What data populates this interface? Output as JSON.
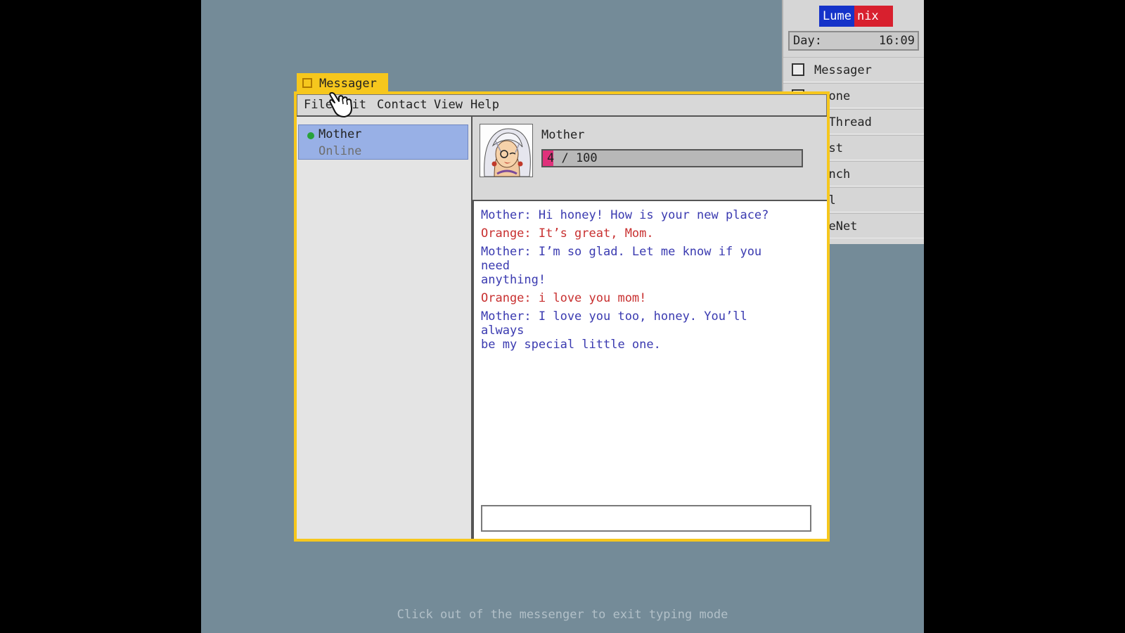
{
  "taskbar": {
    "brand_part1": "Lume",
    "brand_part2": "nix",
    "brand_colors": {
      "blue": "#1533c9",
      "red": "#d8202e"
    },
    "clock_label": "Day:",
    "clock_time": "16:09",
    "items": [
      {
        "label": "Messager"
      },
      {
        "label": "azone"
      },
      {
        "label": "lkThread"
      },
      {
        "label": "tist"
      },
      {
        "label": "Ranch"
      },
      {
        "label": "ail"
      },
      {
        "label": "adeNet"
      }
    ]
  },
  "window": {
    "title": "Messager",
    "accent_color": "#f6c71d",
    "menu": {
      "file": "File",
      "edit": "Edit",
      "contact": "Contact",
      "view": "View",
      "help": "Help"
    }
  },
  "contacts": [
    {
      "name": "Mother",
      "status": "Online",
      "status_color": "#28a23a"
    }
  ],
  "chat": {
    "contact_name": "Mother",
    "affinity_value": 4,
    "affinity_max": 100,
    "affinity_text": "4 / 100",
    "affinity_color": "#e0317b",
    "messages": [
      {
        "speaker": "mother",
        "text": "Mother: Hi honey! How is your new place?"
      },
      {
        "speaker": "orange",
        "text": "Orange: It’s great, Mom."
      },
      {
        "speaker": "mother",
        "text": "Mother: I’m so glad. Let me know if you need\nanything!"
      },
      {
        "speaker": "orange",
        "text": "Orange: i love you mom!"
      },
      {
        "speaker": "mother",
        "text": "Mother: I love you too, honey. You’ll always\nbe my special little one."
      }
    ],
    "input_value": ""
  },
  "hint": "Click out of the messenger to exit typing mode",
  "icons": {
    "cursor": "pointing-hand-cursor-icon",
    "avatar": "mother-portrait"
  }
}
